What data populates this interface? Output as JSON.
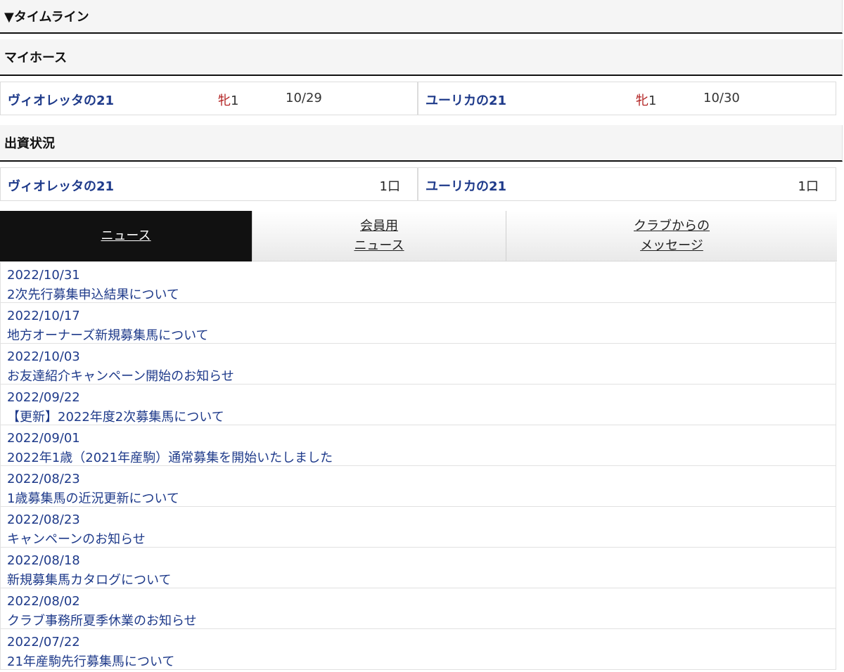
{
  "timeline": {
    "title": "▼タイムライン"
  },
  "my_horse": {
    "title": "マイホース",
    "items": [
      {
        "name": "ヴィオレッタの21",
        "sex": "牝",
        "age": "1",
        "date": "10/29"
      },
      {
        "name": "ユーリカの21",
        "sex": "牝",
        "age": "1",
        "date": "10/30"
      }
    ]
  },
  "investment": {
    "title": "出資状況",
    "items": [
      {
        "name": "ヴィオレッタの21",
        "units": "1口"
      },
      {
        "name": "ユーリカの21",
        "units": "1口"
      }
    ]
  },
  "tabs": [
    {
      "label": "ニュース",
      "active": true
    },
    {
      "label": "会員用\nニュース",
      "active": false
    },
    {
      "label": "クラブからの\nメッセージ",
      "active": false
    }
  ],
  "news": [
    {
      "date": "2022/10/31",
      "title": "2次先行募集申込結果について"
    },
    {
      "date": "2022/10/17",
      "title": "地方オーナーズ新規募集馬について"
    },
    {
      "date": "2022/10/03",
      "title": "お友達紹介キャンペーン開始のお知らせ"
    },
    {
      "date": "2022/09/22",
      "title": "【更新】2022年度2次募集馬について"
    },
    {
      "date": "2022/09/01",
      "title": "2022年1歳（2021年産駒）通常募集を開始いたしました"
    },
    {
      "date": "2022/08/23",
      "title": "1歳募集馬の近況更新について"
    },
    {
      "date": "2022/08/23",
      "title": "キャンペーンのお知らせ"
    },
    {
      "date": "2022/08/18",
      "title": "新規募集馬カタログについて"
    },
    {
      "date": "2022/08/02",
      "title": "クラブ事務所夏季休業のお知らせ"
    },
    {
      "date": "2022/07/22",
      "title": "21年産駒先行募集馬について"
    }
  ],
  "colors": {
    "link": "#1e3a8a",
    "sex": "#b22222",
    "active_tab": "#111111"
  }
}
